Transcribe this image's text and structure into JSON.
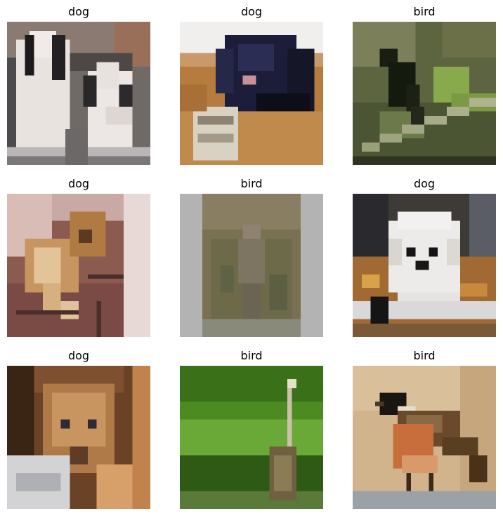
{
  "grid": {
    "items": [
      {
        "label": "dog"
      },
      {
        "label": "dog"
      },
      {
        "label": "bird"
      },
      {
        "label": "dog"
      },
      {
        "label": "bird"
      },
      {
        "label": "dog"
      },
      {
        "label": "dog"
      },
      {
        "label": "bird"
      },
      {
        "label": "bird"
      }
    ]
  }
}
